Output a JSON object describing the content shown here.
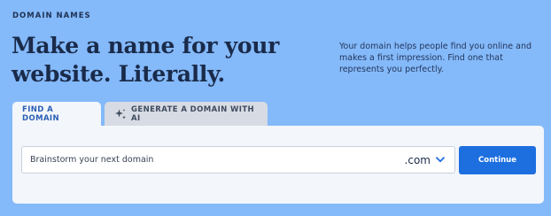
{
  "eyebrow": "DOMAIN NAMES",
  "headline": {
    "line1": "Make a name for your",
    "line2": "website. Literally."
  },
  "blurb": "Your domain helps people find you online and makes a first impression. Find one that represents you perfectly.",
  "tabs": [
    {
      "label": "FIND A DOMAIN",
      "active": true
    },
    {
      "label": "GENERATE A DOMAIN WITH AI",
      "active": false,
      "icon": "sparkle-icon"
    }
  ],
  "search": {
    "placeholder": "Brainstorm your next domain",
    "value": ""
  },
  "tld": {
    "selected": ".com"
  },
  "continue_label": "Continue",
  "colors": {
    "background": "#84b9fa",
    "panel": "#f3f6fb",
    "accent": "#1d6fe0",
    "active_tab_text": "#2a5fb3"
  }
}
